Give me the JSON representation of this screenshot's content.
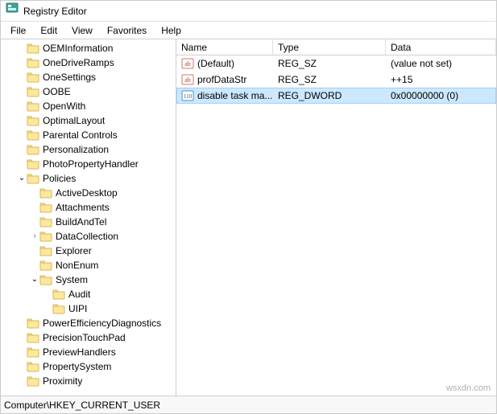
{
  "window": {
    "title": "Registry Editor"
  },
  "menu": {
    "file": "File",
    "edit": "Edit",
    "view": "View",
    "favorites": "Favorites",
    "help": "Help"
  },
  "tree": [
    {
      "label": "OEMInformation",
      "depth": 1,
      "exp": "none"
    },
    {
      "label": "OneDriveRamps",
      "depth": 1,
      "exp": "none"
    },
    {
      "label": "OneSettings",
      "depth": 1,
      "exp": "none"
    },
    {
      "label": "OOBE",
      "depth": 1,
      "exp": "none"
    },
    {
      "label": "OpenWith",
      "depth": 1,
      "exp": "none"
    },
    {
      "label": "OptimalLayout",
      "depth": 1,
      "exp": "none"
    },
    {
      "label": "Parental Controls",
      "depth": 1,
      "exp": "none"
    },
    {
      "label": "Personalization",
      "depth": 1,
      "exp": "none"
    },
    {
      "label": "PhotoPropertyHandler",
      "depth": 1,
      "exp": "none"
    },
    {
      "label": "Policies",
      "depth": 1,
      "exp": "open"
    },
    {
      "label": "ActiveDesktop",
      "depth": 2,
      "exp": "none"
    },
    {
      "label": "Attachments",
      "depth": 2,
      "exp": "none"
    },
    {
      "label": "BuildAndTel",
      "depth": 2,
      "exp": "none"
    },
    {
      "label": "DataCollection",
      "depth": 2,
      "exp": "closed"
    },
    {
      "label": "Explorer",
      "depth": 2,
      "exp": "none"
    },
    {
      "label": "NonEnum",
      "depth": 2,
      "exp": "none"
    },
    {
      "label": "System",
      "depth": 2,
      "exp": "open"
    },
    {
      "label": "Audit",
      "depth": 3,
      "exp": "none"
    },
    {
      "label": "UIPI",
      "depth": 3,
      "exp": "none"
    },
    {
      "label": "PowerEfficiencyDiagnostics",
      "depth": 1,
      "exp": "none"
    },
    {
      "label": "PrecisionTouchPad",
      "depth": 1,
      "exp": "none"
    },
    {
      "label": "PreviewHandlers",
      "depth": 1,
      "exp": "none"
    },
    {
      "label": "PropertySystem",
      "depth": 1,
      "exp": "none"
    },
    {
      "label": "Proximity",
      "depth": 1,
      "exp": "none"
    }
  ],
  "columns": {
    "name": "Name",
    "type": "Type",
    "data": "Data"
  },
  "rows": [
    {
      "icon": "string",
      "name": "(Default)",
      "type": "REG_SZ",
      "data": "(value not set)",
      "selected": false
    },
    {
      "icon": "string",
      "name": "profDataStr",
      "type": "REG_SZ",
      "data": "++15",
      "selected": false
    },
    {
      "icon": "dword",
      "name": "disable task ma...",
      "type": "REG_DWORD",
      "data": "0x00000000 (0)",
      "selected": true
    }
  ],
  "statusbar": "Computer\\HKEY_CURRENT_USER",
  "watermark": "wsxdn.com"
}
